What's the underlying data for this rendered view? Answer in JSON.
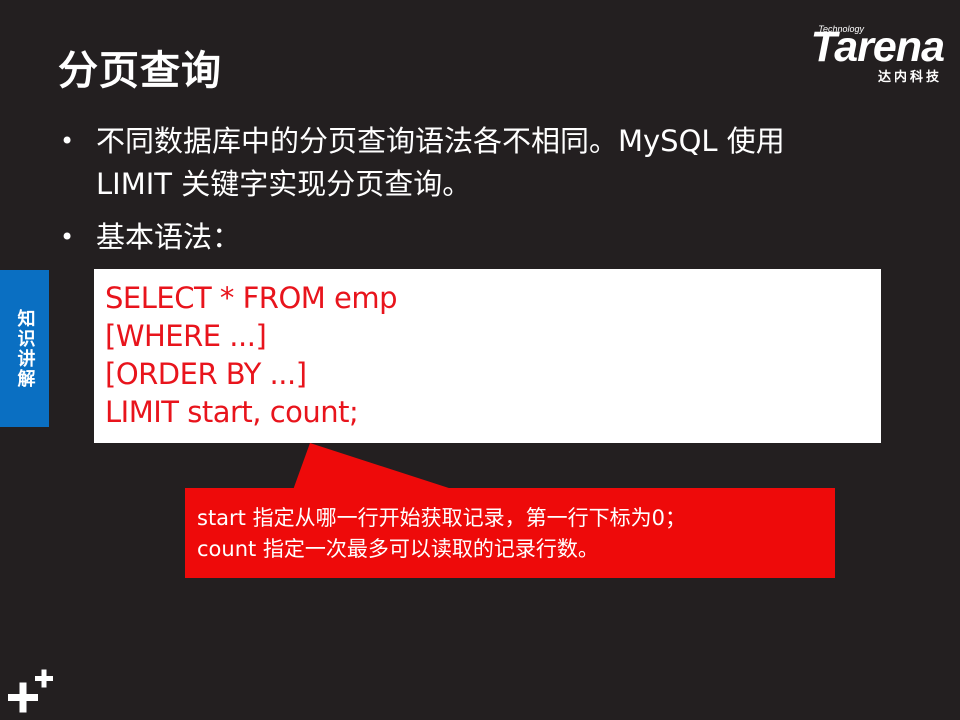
{
  "title": "分页查询",
  "logo": {
    "technology": "Technology",
    "brand": "Tarena",
    "chinese": "达内科技"
  },
  "bullets": [
    {
      "line1": "不同数据库中的分页查询语法各不相同。MySQL 使用",
      "line2": "LIMIT 关键字实现分页查询。"
    },
    {
      "line1": "基本语法："
    }
  ],
  "side_tab": {
    "label": "知识讲解",
    "color": "#0a6fc2"
  },
  "code": [
    "SELECT * FROM emp",
    "[WHERE ...]",
    "[ORDER BY ...]",
    "LIMIT start, count;"
  ],
  "callout": {
    "line1": "start 指定从哪一行开始获取记录，第一行下标为0；",
    "line2": "count 指定一次最多可以读取的记录行数。",
    "color": "#ee0a0a"
  },
  "icons": {
    "bullet": "bullet-dot-icon",
    "corner": "plus-logo-icon"
  },
  "colors": {
    "background": "#231f20",
    "code_text": "#e8141c"
  }
}
